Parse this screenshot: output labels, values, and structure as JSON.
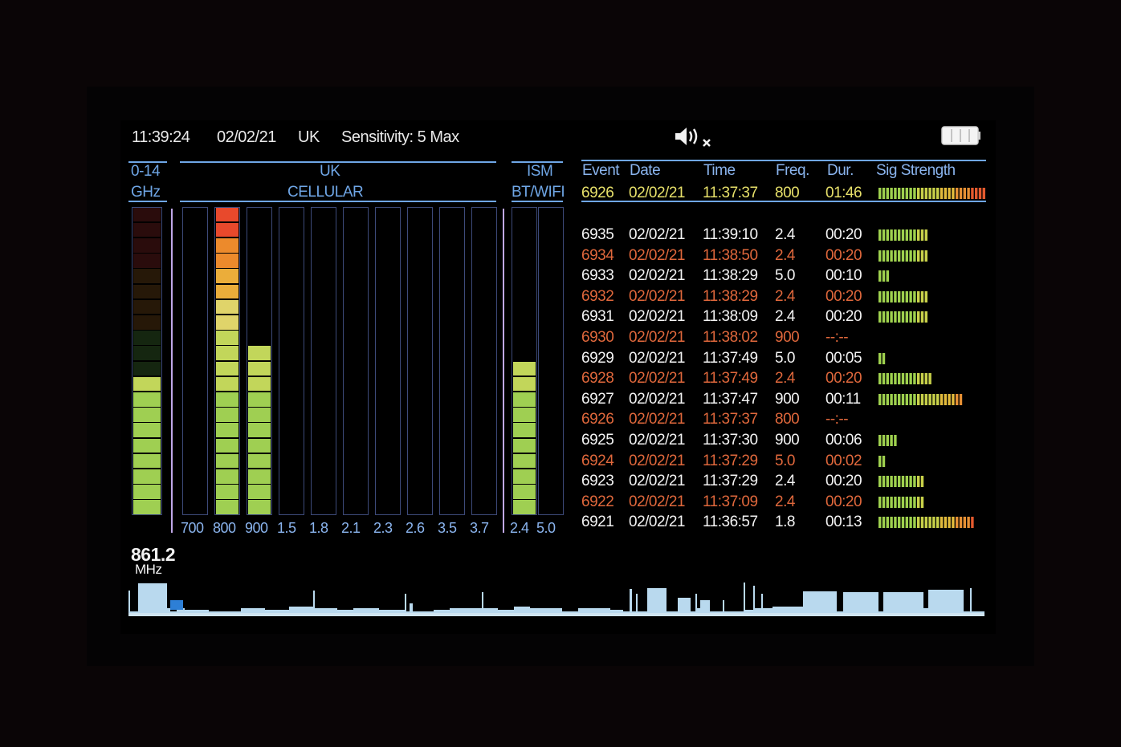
{
  "header": {
    "time": "11:39:24",
    "date": "02/02/21",
    "region": "UK",
    "sensitivity": "Sensitivity: 5 Max",
    "speaker_icon": "speaker-muted-icon",
    "battery_icon": "battery-full-icon"
  },
  "range": {
    "line1": "0-14",
    "line2": "GHz",
    "level": 0.45
  },
  "cellular": {
    "title1": "UK",
    "title2": "CELLULAR",
    "bands": [
      {
        "label": "700",
        "level": 0
      },
      {
        "label": "800",
        "level": 1.0
      },
      {
        "label": "900",
        "level": 0.55
      },
      {
        "label": "1.5",
        "level": 0
      },
      {
        "label": "1.8",
        "level": 0
      },
      {
        "label": "2.1",
        "level": 0
      },
      {
        "label": "2.3",
        "level": 0
      },
      {
        "label": "2.6",
        "level": 0
      },
      {
        "label": "3.5",
        "level": 0
      },
      {
        "label": "3.7",
        "level": 0
      }
    ]
  },
  "ism": {
    "title1": "ISM",
    "title2": "BT/WIFI",
    "bands": [
      {
        "label": "2.4",
        "level": 0.5
      },
      {
        "label": "5.0",
        "level": 0
      }
    ]
  },
  "events": {
    "headers": {
      "event": "Event",
      "date": "Date",
      "time": "Time",
      "freq": "Freq.",
      "dur": "Dur.",
      "sig": "Sig Strength"
    },
    "current": {
      "id": "6926",
      "date": "02/02/21",
      "time": "11:37:37",
      "freq": "800",
      "dur": "01:46",
      "segments": 28
    },
    "rows": [
      {
        "id": "6935",
        "date": "02/02/21",
        "time": "11:39:10",
        "freq": "2.4",
        "dur": "00:20",
        "segments": 13,
        "style": "w"
      },
      {
        "id": "6934",
        "date": "02/02/21",
        "time": "11:38:50",
        "freq": "2.4",
        "dur": "00:20",
        "segments": 13,
        "style": "o"
      },
      {
        "id": "6933",
        "date": "02/02/21",
        "time": "11:38:29",
        "freq": "5.0",
        "dur": "00:10",
        "segments": 3,
        "style": "w"
      },
      {
        "id": "6932",
        "date": "02/02/21",
        "time": "11:38:29",
        "freq": "2.4",
        "dur": "00:20",
        "segments": 13,
        "style": "o"
      },
      {
        "id": "6931",
        "date": "02/02/21",
        "time": "11:38:09",
        "freq": "2.4",
        "dur": "00:20",
        "segments": 13,
        "style": "w"
      },
      {
        "id": "6930",
        "date": "02/02/21",
        "time": "11:38:02",
        "freq": "900",
        "dur": "--:--",
        "segments": 0,
        "style": "o"
      },
      {
        "id": "6929",
        "date": "02/02/21",
        "time": "11:37:49",
        "freq": "5.0",
        "dur": "00:05",
        "segments": 2,
        "style": "w"
      },
      {
        "id": "6928",
        "date": "02/02/21",
        "time": "11:37:49",
        "freq": "2.4",
        "dur": "00:20",
        "segments": 14,
        "style": "o"
      },
      {
        "id": "6927",
        "date": "02/02/21",
        "time": "11:37:47",
        "freq": "900",
        "dur": "00:11",
        "segments": 22,
        "style": "w"
      },
      {
        "id": "6926",
        "date": "02/02/21",
        "time": "11:37:37",
        "freq": "800",
        "dur": "--:--",
        "segments": 0,
        "style": "o"
      },
      {
        "id": "6925",
        "date": "02/02/21",
        "time": "11:37:30",
        "freq": "900",
        "dur": "00:06",
        "segments": 5,
        "style": "w"
      },
      {
        "id": "6924",
        "date": "02/02/21",
        "time": "11:37:29",
        "freq": "5.0",
        "dur": "00:02",
        "segments": 2,
        "style": "o"
      },
      {
        "id": "6923",
        "date": "02/02/21",
        "time": "11:37:29",
        "freq": "2.4",
        "dur": "00:20",
        "segments": 12,
        "style": "w"
      },
      {
        "id": "6922",
        "date": "02/02/21",
        "time": "11:37:09",
        "freq": "2.4",
        "dur": "00:20",
        "segments": 12,
        "style": "o"
      },
      {
        "id": "6921",
        "date": "02/02/21",
        "time": "11:36:57",
        "freq": "1.8",
        "dur": "00:13",
        "segments": 25,
        "style": "w"
      }
    ]
  },
  "frequency": {
    "value": "861.2",
    "unit": "MHz"
  },
  "colors": {
    "accent": "#6fa6e6",
    "warn": "#e0683c",
    "current": "#e7e06a",
    "spectrum": "#b9d9ee",
    "cursor": "#2d7fd6"
  }
}
